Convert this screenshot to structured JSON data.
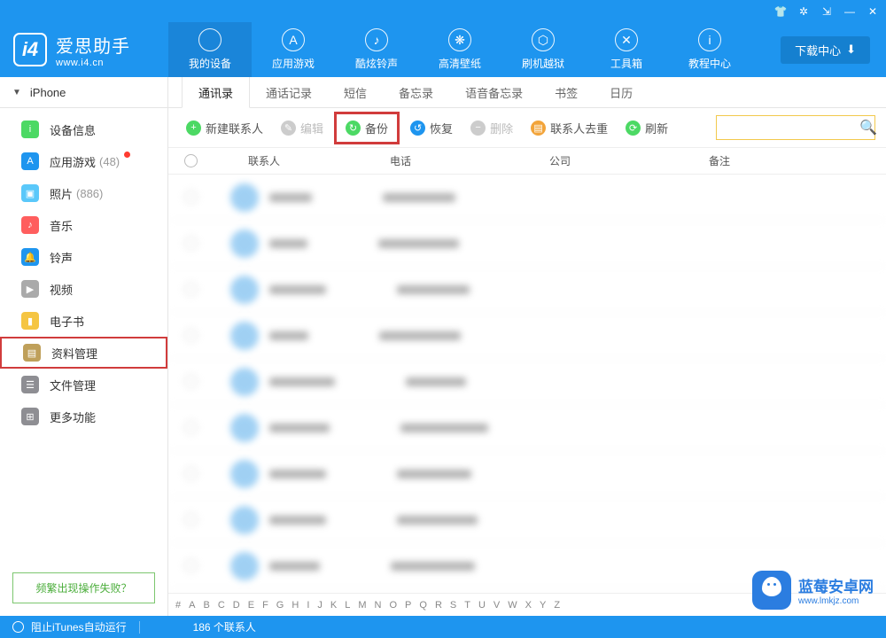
{
  "titlebar_icons": [
    "shirt",
    "gear",
    "pin",
    "min",
    "close"
  ],
  "logo": {
    "cn": "爱思助手",
    "url": "www.i4.cn",
    "badge": "i4"
  },
  "download_btn": "下载中心",
  "nav": [
    {
      "label": "我的设备",
      "icon": "",
      "active": true
    },
    {
      "label": "应用游戏",
      "icon": "A"
    },
    {
      "label": "酷炫铃声",
      "icon": "♪"
    },
    {
      "label": "高清壁纸",
      "icon": "❋"
    },
    {
      "label": "刷机越狱",
      "icon": "⬡"
    },
    {
      "label": "工具箱",
      "icon": "✕"
    },
    {
      "label": "教程中心",
      "icon": "i"
    }
  ],
  "device_name": "iPhone",
  "sidebar": [
    {
      "label": "设备信息",
      "count": "",
      "color": "#4cd964",
      "glyph": "i"
    },
    {
      "label": "应用游戏",
      "count": "(48)",
      "dot": true,
      "color": "#1e95ef",
      "glyph": "A"
    },
    {
      "label": "照片",
      "count": "(886)",
      "color": "#5ac8fa",
      "glyph": "▣"
    },
    {
      "label": "音乐",
      "count": "",
      "color": "#ff5e5e",
      "glyph": "♪"
    },
    {
      "label": "铃声",
      "count": "",
      "color": "#1e95ef",
      "glyph": "🔔"
    },
    {
      "label": "视频",
      "count": "",
      "color": "#aaa",
      "glyph": "▶"
    },
    {
      "label": "电子书",
      "count": "",
      "color": "#f5c542",
      "glyph": "▮"
    },
    {
      "label": "资料管理",
      "count": "",
      "selected": true,
      "color": "#bfa05a",
      "glyph": "▤"
    },
    {
      "label": "文件管理",
      "count": "",
      "color": "#8e8e93",
      "glyph": "☰"
    },
    {
      "label": "更多功能",
      "count": "",
      "color": "#8e8e93",
      "glyph": "⊞"
    }
  ],
  "help_link": "频繁出现操作失败？",
  "tabs": [
    "通讯录",
    "通话记录",
    "短信",
    "备忘录",
    "语音备忘录",
    "书签",
    "日历"
  ],
  "active_tab": 0,
  "toolbar": [
    {
      "label": "新建联系人",
      "icon_bg": "#4cd964",
      "glyph": "+",
      "enabled": true
    },
    {
      "label": "编辑",
      "icon_bg": "#ccc",
      "glyph": "✎",
      "enabled": false
    },
    {
      "label": "备份",
      "icon_bg": "#4cd964",
      "glyph": "↻",
      "enabled": true,
      "highlight": true
    },
    {
      "label": "恢复",
      "icon_bg": "#1e95ef",
      "glyph": "↺",
      "enabled": true
    },
    {
      "label": "删除",
      "icon_bg": "#ccc",
      "glyph": "−",
      "enabled": false
    },
    {
      "label": "联系人去重",
      "icon_bg": "#f2a43a",
      "glyph": "▤",
      "enabled": true
    },
    {
      "label": "刷新",
      "icon_bg": "#4cd964",
      "glyph": "⟳",
      "enabled": true
    }
  ],
  "search_placeholder": "",
  "columns": {
    "name": "联系人",
    "phone": "电话",
    "company": "公司",
    "notes": "备注"
  },
  "row_count": 9,
  "alpha": [
    "#",
    "A",
    "B",
    "C",
    "D",
    "E",
    "F",
    "G",
    "H",
    "I",
    "J",
    "K",
    "L",
    "M",
    "N",
    "O",
    "P",
    "Q",
    "R",
    "S",
    "T",
    "U",
    "V",
    "W",
    "X",
    "Y",
    "Z"
  ],
  "status": {
    "stop": "阻止iTunes自动运行",
    "count": "186 个联系人"
  },
  "watermark": {
    "cn": "蓝莓安卓网",
    "url": "www.lmkjz.com"
  }
}
